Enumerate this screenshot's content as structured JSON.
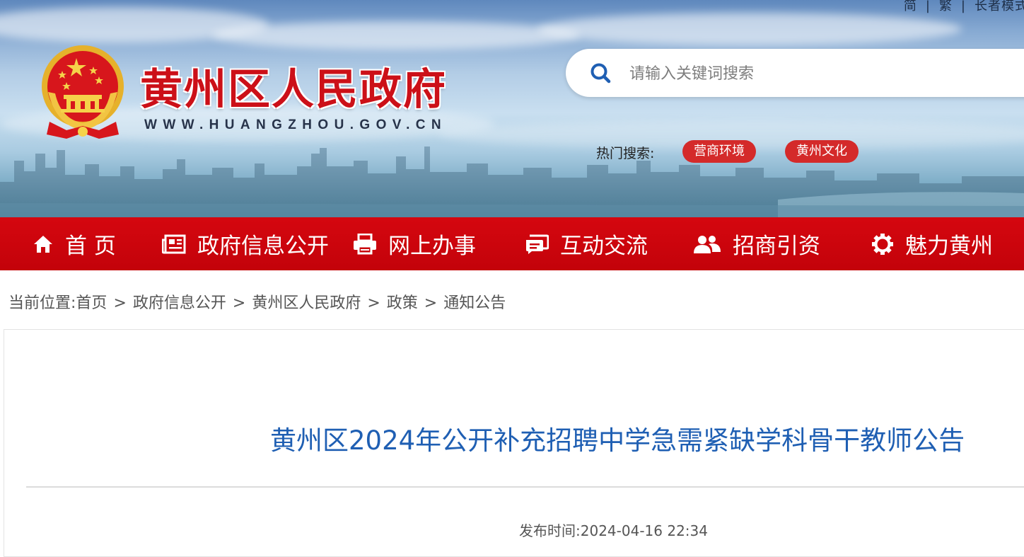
{
  "header": {
    "top_links": [
      "简",
      "繁",
      "长者模式"
    ],
    "site_title": "黄州区人民政府",
    "site_url": "WWW.HUANGZHOU.GOV.CN",
    "search": {
      "placeholder": "请输入关键词搜索"
    },
    "hot_search_label": "热门搜索:",
    "hot_tags": [
      "营商环境",
      "黄州文化"
    ]
  },
  "nav": {
    "items": [
      {
        "label": "首 页",
        "icon": "home-icon"
      },
      {
        "label": "政府信息公开",
        "icon": "newspaper-icon"
      },
      {
        "label": "网上办事",
        "icon": "printer-icon"
      },
      {
        "label": "互动交流",
        "icon": "chat-icon"
      },
      {
        "label": "招商引资",
        "icon": "users-icon"
      },
      {
        "label": "魅力黄州",
        "icon": "gear-icon"
      }
    ]
  },
  "breadcrumb": {
    "prefix": "当前位置:",
    "items": [
      "首页",
      "政府信息公开",
      "黄州区人民政府",
      "政策",
      "通知公告"
    ],
    "separator": ">"
  },
  "article": {
    "title": "黄州区2024年公开补充招聘中学急需紧缺学科骨干教师公告",
    "publish_label": "发布时间:",
    "publish_time": "2024-04-16 22:34"
  },
  "colors": {
    "nav_red": "#c9040c",
    "title_red": "#cc1018",
    "tag_red": "#d42a2a",
    "article_title_blue": "#1f5fb3"
  }
}
